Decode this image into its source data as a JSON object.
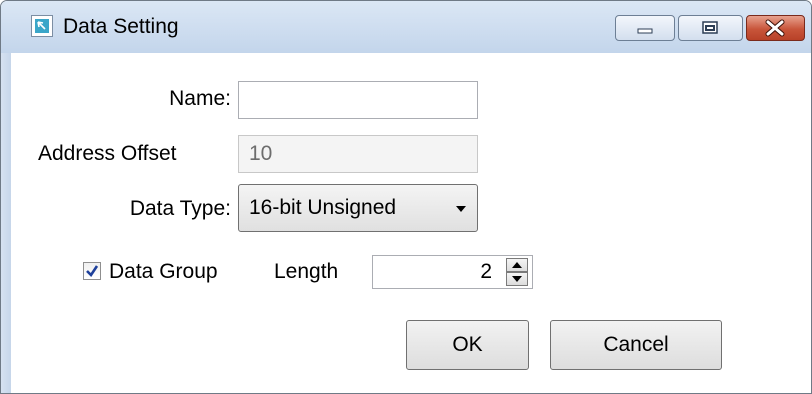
{
  "window": {
    "title": "Data Setting",
    "icon": "app-icon"
  },
  "caption_buttons": [
    "minimize-icon",
    "maximize-icon",
    "close-icon"
  ],
  "form": {
    "name_label": "Name:",
    "name_value": "",
    "address_offset_label": "Address Offset",
    "address_offset_value": "10",
    "data_type_label": "Data Type:",
    "data_type_value": "16-bit Unsigned",
    "data_group_label": "Data Group",
    "data_group_checked": true,
    "length_label": "Length",
    "length_value": "2"
  },
  "buttons": {
    "ok_label": "OK",
    "cancel_label": "Cancel"
  },
  "colors": {
    "titlebar": "#c3d5eb",
    "close_button": "#c8553a",
    "checkmark": "#1d3f9a"
  }
}
